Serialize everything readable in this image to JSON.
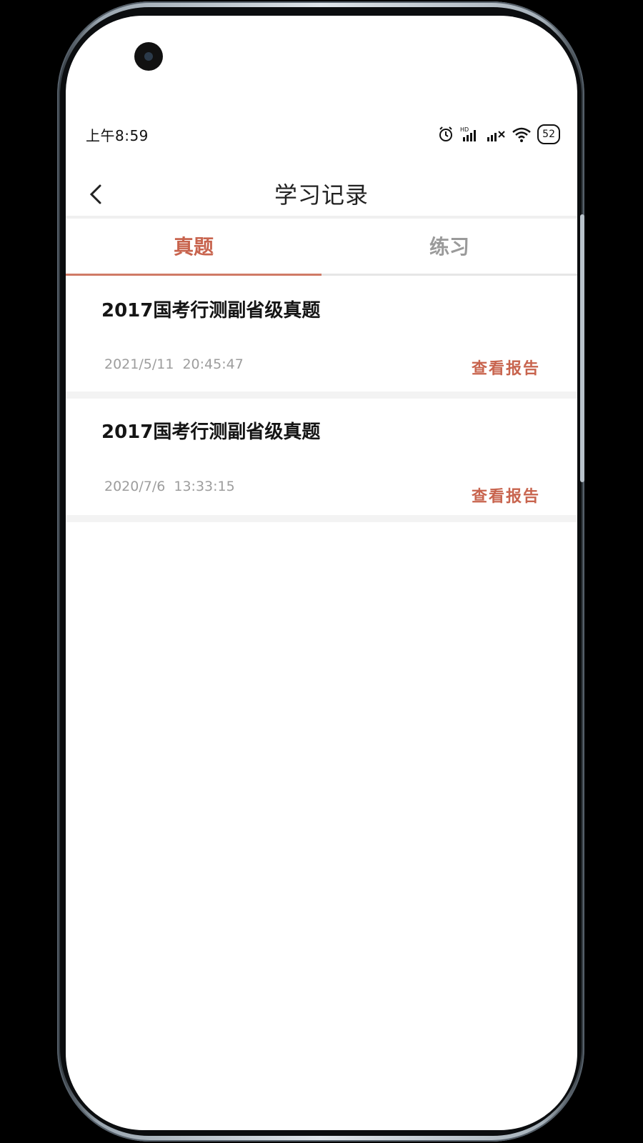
{
  "status_bar": {
    "time": "上午8:59",
    "battery": "52",
    "icons": [
      "alarm-icon",
      "hd-signal-icon",
      "signal-icon",
      "wifi-icon",
      "battery-icon"
    ],
    "network_label": "HD"
  },
  "header": {
    "title": "学习记录",
    "back_icon": "chevron-left-icon"
  },
  "tabs": [
    {
      "label": "真题",
      "active": true
    },
    {
      "label": "练习",
      "active": false
    }
  ],
  "records": [
    {
      "title": "2017国考行测副省级真题",
      "time": "2021/5/11 20:45:47",
      "action": "查看报告"
    },
    {
      "title": "2017国考行测副省级真题",
      "time": "2020/7/6 13:33:15",
      "action": "查看报告"
    }
  ],
  "colors": {
    "accent": "#c8644e",
    "muted_text": "#9d9d9d",
    "divider": "#f3f3f3"
  }
}
